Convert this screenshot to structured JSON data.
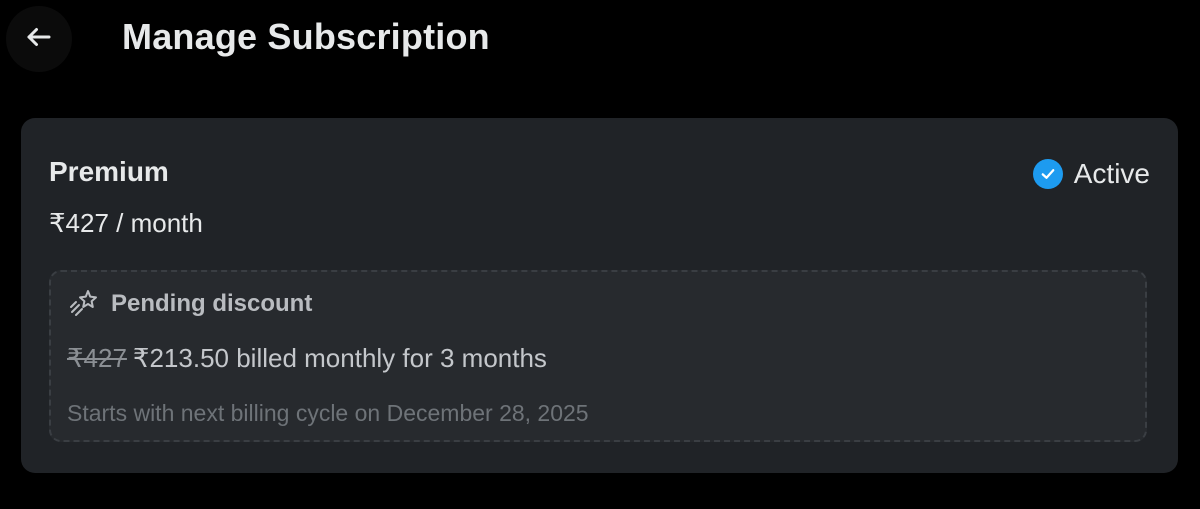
{
  "header": {
    "title": "Manage Subscription",
    "back_icon": "arrow-left-icon"
  },
  "subscription": {
    "plan_name": "Premium",
    "price": "₹427 / month",
    "status": {
      "label": "Active",
      "icon": "check-circle-icon",
      "color": "#1d9bf0"
    },
    "pending_discount": {
      "icon": "sparkle-icon",
      "title": "Pending discount",
      "old_price": "₹427",
      "new_price_text": "₹213.50 billed monthly for 3 months",
      "note": "Starts with next billing cycle on December 28, 2025"
    }
  },
  "colors": {
    "background": "#000000",
    "card": "#202327",
    "accent": "#1d9bf0"
  }
}
